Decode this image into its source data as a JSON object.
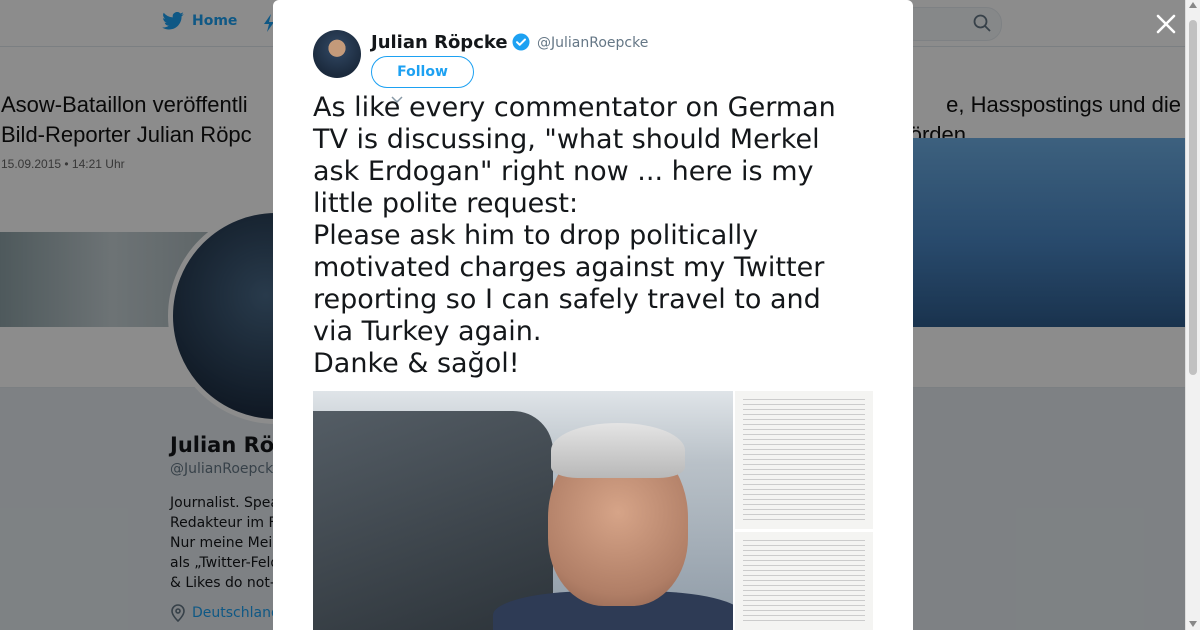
{
  "background": {
    "nav": {
      "home_label": "Home"
    },
    "news": {
      "headline_line1": "Asow-Bataillon veröffentli",
      "headline_line1_right": "e, Hasspostings und die",
      "headline_line2": "Bild-Reporter Julian Röpc",
      "headline_line2_right": "örden",
      "date": "15.09.2015 • 14:21 Uhr"
    },
    "profile": {
      "name": "Julian Rö",
      "handle": "@JulianRoepck",
      "bio_lines": [
        "Journalist. Spea",
        "Redakteur im F",
        "Nur meine Mei",
        "als „Twitter-Feld",
        "& Likes do not-"
      ],
      "location": "Deutschland"
    }
  },
  "modal": {
    "author": {
      "name": "Julian Röpcke",
      "handle": "@JulianRoepcke",
      "verified": true
    },
    "follow_label": "Follow",
    "tweet_lines": [
      "As like every commentator on German",
      "TV is discussing, \"what should Merkel",
      "ask Erdogan\" right now ... here is my",
      "little polite request:",
      "Please ask him to drop politically",
      "motivated charges against my Twitter",
      "reporting so I can safely travel to and",
      "via Turkey again.",
      "Danke & sağol!"
    ]
  },
  "colors": {
    "accent": "#1da1f2",
    "text": "#14171a",
    "muted": "#657786"
  },
  "icons": [
    "twitter-bird-icon",
    "moments-icon",
    "search-icon",
    "close-icon",
    "verified-icon",
    "caret-down-icon",
    "location-pin-icon"
  ]
}
